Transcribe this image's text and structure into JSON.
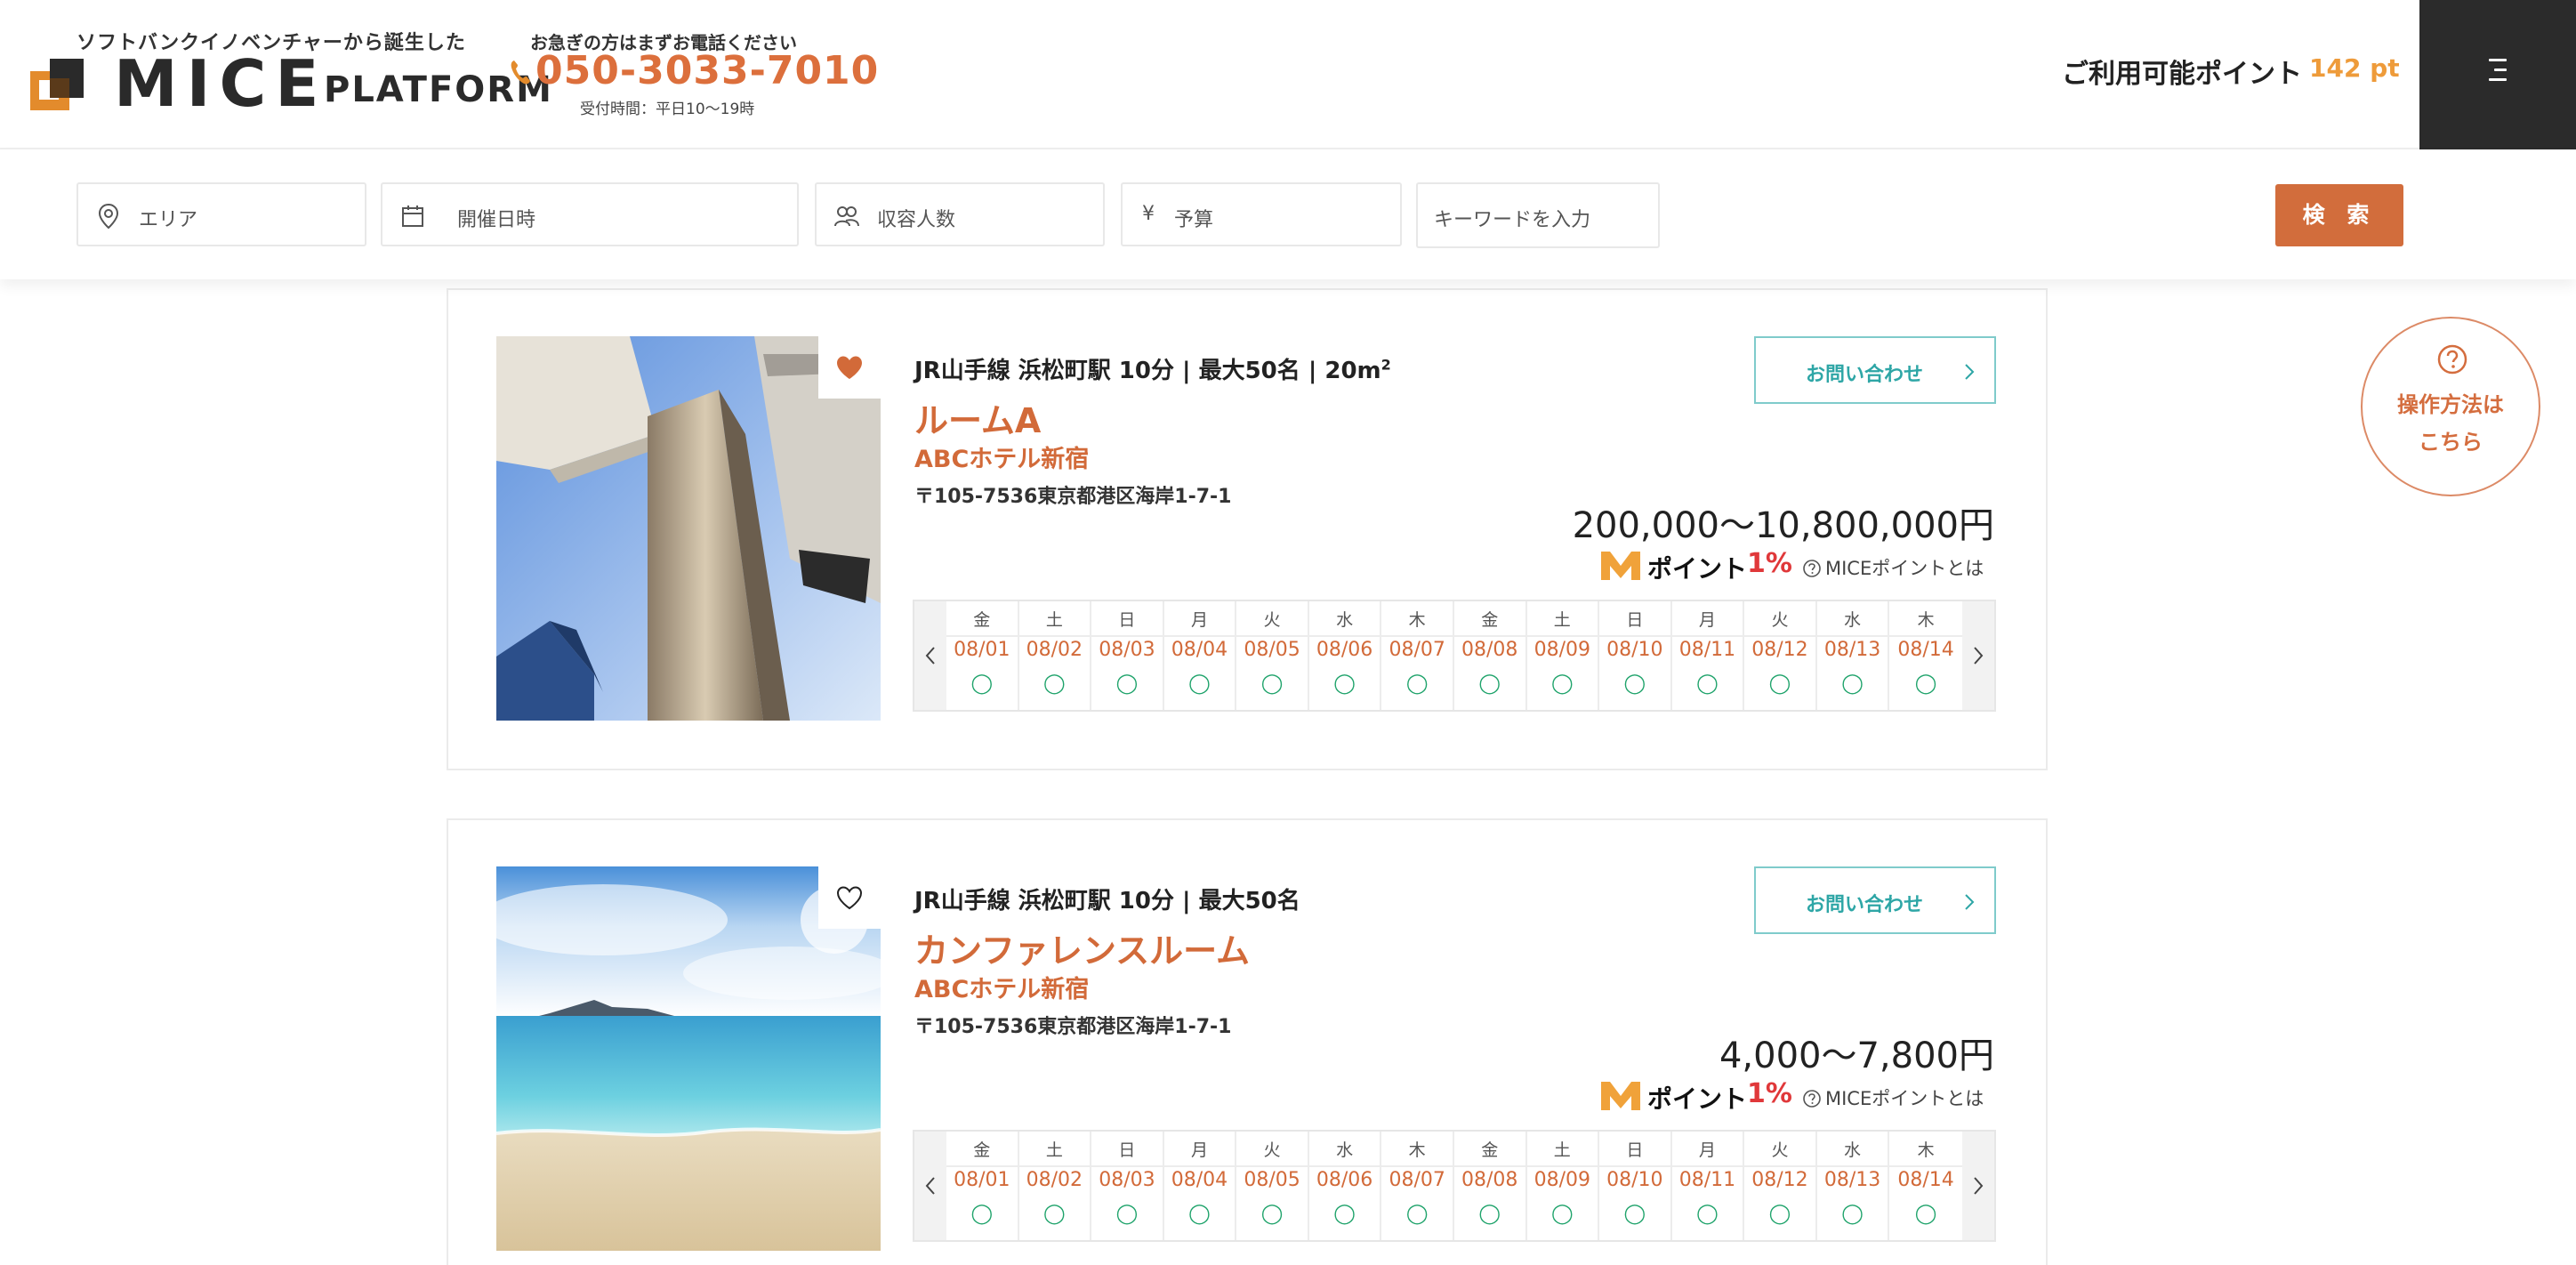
{
  "header": {
    "tagline": "ソフトバンクイノベンチャーから誕生した",
    "logo_text": "MICE",
    "logo_platform": "PLATFORM",
    "call_note": "お急ぎの方はまずお電話ください",
    "phone": "050-3033-7010",
    "hours": "受付時間：平日10〜19時",
    "points_label": "ご利用可能ポイント",
    "points_value": "142 pt",
    "brand_color": "#dc6f3c"
  },
  "search": {
    "area_placeholder": "エリア",
    "date_placeholder": "開催日時",
    "capacity_placeholder": "収容人数",
    "budget_placeholder": "予算",
    "keyword_placeholder": "キーワードを入力",
    "search_label": "検 索"
  },
  "help": {
    "line1": "操作方法は",
    "line2": "こちら"
  },
  "cards": [
    {
      "access": "JR山手線 浜松町駅 10分 | 最大50名 | 20m",
      "area_unit_sup": "2",
      "room_name": "ルームA",
      "hotel_name": "ABCホテル新宿",
      "address": "〒105-7536東京都港区海岸1-7-1",
      "inquiry_label": "お問い合わせ",
      "price": "200,000〜10,800,000円",
      "point_word": "ポイント",
      "point_pct": "1%",
      "point_info": "MICEポイントとは",
      "favorited": true
    },
    {
      "access": "JR山手線 浜松町駅 10分 | 最大50名",
      "area_unit_sup": "",
      "room_name": "カンファレンスルーム",
      "hotel_name": "ABCホテル新宿",
      "address": "〒105-7536東京都港区海岸1-7-1",
      "inquiry_label": "お問い合わせ",
      "price": "4,000〜7,800円",
      "point_word": "ポイント",
      "point_pct": "1%",
      "point_info": "MICEポイントとは",
      "favorited": false
    }
  ],
  "calendar": {
    "days": [
      {
        "dow": "金",
        "date": "08/01",
        "avail": "◯"
      },
      {
        "dow": "土",
        "date": "08/02",
        "avail": "◯"
      },
      {
        "dow": "日",
        "date": "08/03",
        "avail": "◯"
      },
      {
        "dow": "月",
        "date": "08/04",
        "avail": "◯"
      },
      {
        "dow": "火",
        "date": "08/05",
        "avail": "◯"
      },
      {
        "dow": "水",
        "date": "08/06",
        "avail": "◯"
      },
      {
        "dow": "木",
        "date": "08/07",
        "avail": "◯"
      },
      {
        "dow": "金",
        "date": "08/08",
        "avail": "◯"
      },
      {
        "dow": "土",
        "date": "08/09",
        "avail": "◯"
      },
      {
        "dow": "日",
        "date": "08/10",
        "avail": "◯"
      },
      {
        "dow": "月",
        "date": "08/11",
        "avail": "◯"
      },
      {
        "dow": "火",
        "date": "08/12",
        "avail": "◯"
      },
      {
        "dow": "水",
        "date": "08/13",
        "avail": "◯"
      },
      {
        "dow": "木",
        "date": "08/14",
        "avail": "◯"
      }
    ]
  }
}
